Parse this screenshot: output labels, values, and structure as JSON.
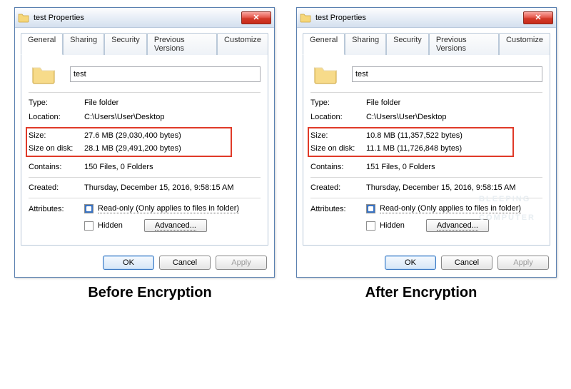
{
  "watermark_line1": "BLEEPING",
  "watermark_line2": "COMPUTER",
  "dialogs": [
    {
      "title": "test Properties",
      "tabs": [
        "General",
        "Sharing",
        "Security",
        "Previous Versions",
        "Customize"
      ],
      "active_tab": "General",
      "folder_name": "test",
      "type_label": "Type:",
      "type_value": "File folder",
      "location_label": "Location:",
      "location_value": "C:\\Users\\User\\Desktop",
      "size_label": "Size:",
      "size_value": "27.6 MB (29,030,400 bytes)",
      "size_on_disk_label": "Size on disk:",
      "size_on_disk_value": "28.1 MB (29,491,200 bytes)",
      "contains_label": "Contains:",
      "contains_value": "150 Files, 0 Folders",
      "created_label": "Created:",
      "created_value": "Thursday, December 15, 2016, 9:58:15 AM",
      "attributes_label": "Attributes:",
      "readonly_label": "Read-only (Only applies to files in folder)",
      "hidden_label": "Hidden",
      "advanced_label": "Advanced...",
      "ok_label": "OK",
      "cancel_label": "Cancel",
      "apply_label": "Apply",
      "caption": "Before Encryption"
    },
    {
      "title": "test Properties",
      "tabs": [
        "General",
        "Sharing",
        "Security",
        "Previous Versions",
        "Customize"
      ],
      "active_tab": "General",
      "folder_name": "test",
      "type_label": "Type:",
      "type_value": "File folder",
      "location_label": "Location:",
      "location_value": "C:\\Users\\User\\Desktop",
      "size_label": "Size:",
      "size_value": "10.8 MB (11,357,522 bytes)",
      "size_on_disk_label": "Size on disk:",
      "size_on_disk_value": "11.1 MB (11,726,848 bytes)",
      "contains_label": "Contains:",
      "contains_value": "151 Files, 0 Folders",
      "created_label": "Created:",
      "created_value": "Thursday, December 15, 2016, 9:58:15 AM",
      "attributes_label": "Attributes:",
      "readonly_label": "Read-only (Only applies to files in folder)",
      "hidden_label": "Hidden",
      "advanced_label": "Advanced...",
      "ok_label": "OK",
      "cancel_label": "Cancel",
      "apply_label": "Apply",
      "caption": "After Encryption"
    }
  ]
}
